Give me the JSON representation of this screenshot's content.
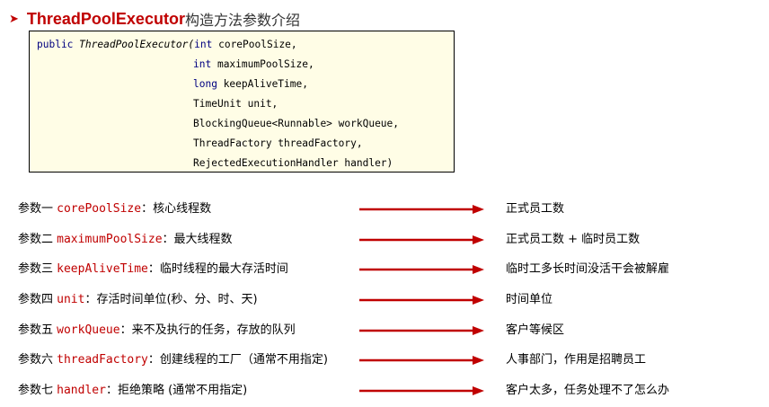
{
  "title": {
    "main": "ThreadPoolExecutor",
    "rest": "构造方法参数介绍"
  },
  "code": {
    "line1": {
      "kw": "public ",
      "name": "ThreadPoolExecutor(",
      "type": "int",
      "param": " corePoolSize,"
    },
    "line2": {
      "type": "int",
      "param": " maximumPoolSize,"
    },
    "line3": {
      "type": "long",
      "param": " keepAliveTime,"
    },
    "line4": {
      "text": "TimeUnit unit,"
    },
    "line5": {
      "text": "BlockingQueue<Runnable> workQueue,"
    },
    "line6": {
      "text": "ThreadFactory threadFactory,"
    },
    "line7": {
      "text": "RejectedExecutionHandler handler)"
    }
  },
  "params": [
    {
      "prefix": "参数一 ",
      "name": "corePoolSize",
      "desc": "：核心线程数",
      "analogy": "正式员工数"
    },
    {
      "prefix": "参数二 ",
      "name": "maximumPoolSize",
      "desc": "：最大线程数",
      "analogy": "正式员工数 + 临时员工数"
    },
    {
      "prefix": "参数三 ",
      "name": "keepAliveTime",
      "desc": "：临时线程的最大存活时间",
      "analogy": "临时工多长时间没活干会被解雇"
    },
    {
      "prefix": "参数四 ",
      "name": "unit",
      "desc": "：存活时间单位(秒、分、时、天)",
      "analogy": "时间单位"
    },
    {
      "prefix": "参数五 ",
      "name": "workQueue",
      "desc": "：来不及执行的任务，存放的队列",
      "analogy": "客户等候区"
    },
    {
      "prefix": "参数六 ",
      "name": "threadFactory",
      "desc": "：创建线程的工厂（通常不用指定)",
      "analogy": "人事部门，作用是招聘员工"
    },
    {
      "prefix": "参数七 ",
      "name": "handler",
      "desc": "：拒绝策略 (通常不用指定)",
      "analogy": "客户太多，任务处理不了怎么办"
    }
  ],
  "colors": {
    "accent": "#c00000",
    "code_keyword": "#000080",
    "code_bg": "#fffde6"
  },
  "icons": {
    "bullet": "arrow-bullet-icon",
    "row_arrow": "right-arrow-icon"
  }
}
